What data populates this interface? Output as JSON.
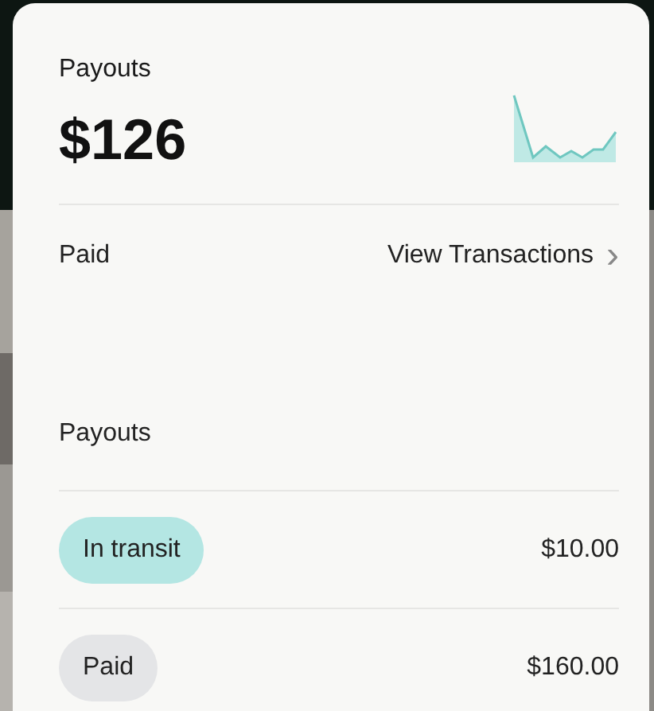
{
  "card": {
    "title": "Payouts",
    "amount": "$126",
    "status_label": "Paid",
    "link": "View Transactions",
    "link_icon": "›"
  },
  "payouts": {
    "title": "Payouts",
    "rows": [
      {
        "status": "In transit",
        "color": "#b4e6e3",
        "amount": "$10.00"
      },
      {
        "status": "Paid",
        "color": "#e4e5e7",
        "amount": "$160.00"
      }
    ]
  }
}
